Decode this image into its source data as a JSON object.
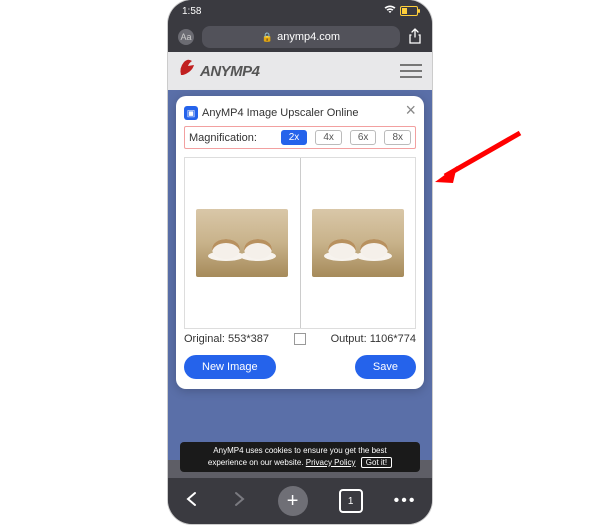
{
  "status": {
    "time": "1:58"
  },
  "browser": {
    "domain": "anymp4.com",
    "tab_count": "1"
  },
  "header": {
    "brand": "ANYMP4"
  },
  "modal": {
    "title": "AnyMP4 Image Upscaler Online",
    "mag_label": "Magnification:",
    "options": {
      "opt2": "2x",
      "opt4": "4x",
      "opt6": "6x",
      "opt8": "8x"
    },
    "original_label": "Original: 553*387",
    "output_label": "Output: 1106*774",
    "new_image": "New Image",
    "save": "Save"
  },
  "cookie": {
    "line1": "AnyMP4 uses cookies to ensure you get the best",
    "line2": "experience on our website.",
    "privacy": "Privacy Policy",
    "gotit": "Got it!"
  }
}
